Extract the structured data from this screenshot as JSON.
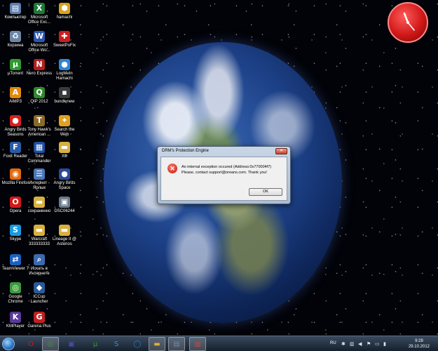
{
  "desktop_icons": [
    {
      "name": "computer",
      "label": "Компьютер",
      "glyph": "▤",
      "color": "#5e7fb0"
    },
    {
      "name": "office-excel",
      "label": "Microsoft Office Exc...",
      "glyph": "X",
      "color": "#1e7a3a"
    },
    {
      "name": "hamachi",
      "label": "hamachi",
      "glyph": "⬢",
      "color": "#d6a21c"
    },
    {
      "name": "recycle-bin",
      "label": "Корзина",
      "glyph": "♻",
      "color": "#6c86a8"
    },
    {
      "name": "office-word",
      "label": "Microsoft Office Wo...",
      "glyph": "W",
      "color": "#2a56b0"
    },
    {
      "name": "sweetpofix",
      "label": "SweetPoFix",
      "glyph": "✚",
      "color": "#c81e1e"
    },
    {
      "name": "utorrent",
      "label": "µTorrent",
      "glyph": "µ",
      "color": "#2f9a2f"
    },
    {
      "name": "nero-express",
      "label": "Nero Express",
      "glyph": "N",
      "color": "#b02020"
    },
    {
      "name": "logmein-hamachi",
      "label": "LogMeIn Hamachi",
      "glyph": "●",
      "color": "#2e86d6"
    },
    {
      "name": "aimp3",
      "label": "AIMP3",
      "glyph": "A",
      "color": "#e08a10"
    },
    {
      "name": "qip-2012",
      "label": "QIP 2012",
      "glyph": "Q",
      "color": "#2d8a2d"
    },
    {
      "name": "bundlenew",
      "label": "bundlenew",
      "glyph": "▪",
      "color": "#3a3a3a"
    },
    {
      "name": "angry-birds-seasons",
      "label": "Angry Birds Seasons",
      "glyph": "●",
      "color": "#d62020"
    },
    {
      "name": "tony-hawk",
      "label": "Tony Hawk's American ...",
      "glyph": "T",
      "color": "#8a6a2a"
    },
    {
      "name": "search-the-web",
      "label": "Search the Web",
      "glyph": "✦",
      "color": "#e0a020"
    },
    {
      "name": "foxit-reader",
      "label": "Foxit Reader",
      "glyph": "F",
      "color": "#2a5aa8"
    },
    {
      "name": "total-commander",
      "label": "Total Commander",
      "glyph": "▦",
      "color": "#1e4ea0"
    },
    {
      "name": "folder-xf",
      "label": "ХФ",
      "glyph": "▬",
      "color": "#d8b040"
    },
    {
      "name": "mozilla-firefox",
      "label": "Mozilla Firefox",
      "glyph": "◉",
      "color": "#e06a10"
    },
    {
      "name": "internet-shortcut",
      "label": "Интернет - Ярлык",
      "glyph": "☰",
      "color": "#4a78b8"
    },
    {
      "name": "angry-birds-space",
      "label": "Angry Birds Space",
      "glyph": "●",
      "color": "#2a4a9a"
    },
    {
      "name": "opera",
      "label": "Opera",
      "glyph": "O",
      "color": "#d01a1a"
    },
    {
      "name": "saved-folder",
      "label": "сохраненно",
      "glyph": "▬",
      "color": "#d8b040"
    },
    {
      "name": "dsc06244",
      "label": "DSC06244",
      "glyph": "▣",
      "color": "#6a7a8a"
    },
    {
      "name": "skype",
      "label": "Skype",
      "glyph": "S",
      "color": "#1a9ae0"
    },
    {
      "name": "warcraft-folder",
      "label": "Warcraft 333333333",
      "glyph": "▬",
      "color": "#d8b040"
    },
    {
      "name": "lineage2-folder",
      "label": "Lineage II @ Asterios",
      "glyph": "▬",
      "color": "#d8b040"
    },
    {
      "name": "teamviewer",
      "label": "TeamViewer 7",
      "glyph": "⇄",
      "color": "#1a60c0"
    },
    {
      "name": "search-internet",
      "label": "Искать в Интернете",
      "glyph": "⌕",
      "color": "#3a6ab0"
    },
    {
      "name": "google-chrome",
      "label": "Google Chrome",
      "glyph": "◎",
      "color": "#3a9a3a"
    },
    {
      "name": "iccup-launcher",
      "label": "ICCup Launcher",
      "glyph": "◆",
      "color": "#2a5a9a"
    },
    {
      "name": "kmplayer",
      "label": "KMPlayer",
      "glyph": "K",
      "color": "#5a3a9a"
    },
    {
      "name": "garena-plus",
      "label": "Garena Plus",
      "glyph": "G",
      "color": "#c02020"
    }
  ],
  "dialog": {
    "title": "DRM's Protection Engine",
    "close_label": "✕",
    "message_line1": "An internal exception occured (Address:0x770004f7)",
    "message_line2": "Please, contact support@oreans.com. Thank you!",
    "ok_label": "OK"
  },
  "taskbar": {
    "buttons": [
      {
        "name": "opera",
        "glyph": "O",
        "color": "#d01a1a"
      },
      {
        "name": "chrome",
        "glyph": "◎",
        "color": "#3a9a3a",
        "active": true
      },
      {
        "name": "save",
        "glyph": "▣",
        "color": "#4a4ab0"
      },
      {
        "name": "utorrent",
        "glyph": "µ",
        "color": "#2f9a2f"
      },
      {
        "name": "skype",
        "glyph": "S",
        "color": "#1a9ae0"
      },
      {
        "name": "search",
        "glyph": "◯",
        "color": "#2a7ad0"
      },
      {
        "name": "explorer",
        "glyph": "▬",
        "color": "#d8b040",
        "active": true
      },
      {
        "name": "app-window",
        "glyph": "▤",
        "color": "#6a8ab0",
        "active": true
      },
      {
        "name": "app-error",
        "glyph": "▦",
        "color": "#c04040",
        "active": true
      }
    ],
    "tray": {
      "lang": "RU",
      "time": "9:28",
      "date": "29.10.2012"
    }
  }
}
